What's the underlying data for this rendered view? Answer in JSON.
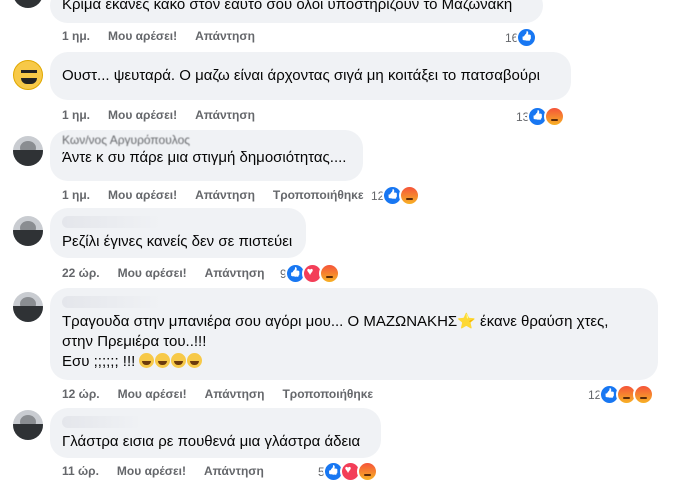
{
  "actions": {
    "like_label": "Μου αρέσει!",
    "reply_label": "Απάντηση",
    "edited_label": "Τροποποιήθηκε"
  },
  "comments": [
    {
      "text": "Κρίμα έκανες κακό στον εαυτό σου όλοι υποστηρίζουν το Μαζωνάκη",
      "time": "1 ημ.",
      "reactions": "16"
    },
    {
      "text": "Ουστ... ψευταρά. Ο μαζω είναι άρχοντας σιγά μη κοιτάξει το πατσαβούρι",
      "time": "1 ημ.",
      "reactions": "13"
    },
    {
      "name": "Κων/νος Αργυρόπουλος",
      "text": "Άντε κ συ πάρε μια στιγμή δημοσιότητας....",
      "time": "1 ημ.",
      "reactions": "12"
    },
    {
      "text": "Ρεζίλι έγινες κανείς δεν σε πιστεύει",
      "time": "22 ώρ.",
      "reactions": "9"
    },
    {
      "text_line1a": "Τραγουδα στην μπανιέρα σου αγόρι μου... Ο ΜΑΖΩΝΑΚΗΣ",
      "text_line1b": " έκανε θραύση χτες,",
      "text_line2": "στην Πρεμιέρα του..!!!",
      "text_line3": "Εσυ ;;;;;; !!! ",
      "time": "12 ώρ.",
      "reactions": "12"
    },
    {
      "text": "Γλάστρα εισια ρε πουθενά μια γλάστρα άδεια",
      "time": "11 ώρ.",
      "reactions": "5"
    }
  ]
}
